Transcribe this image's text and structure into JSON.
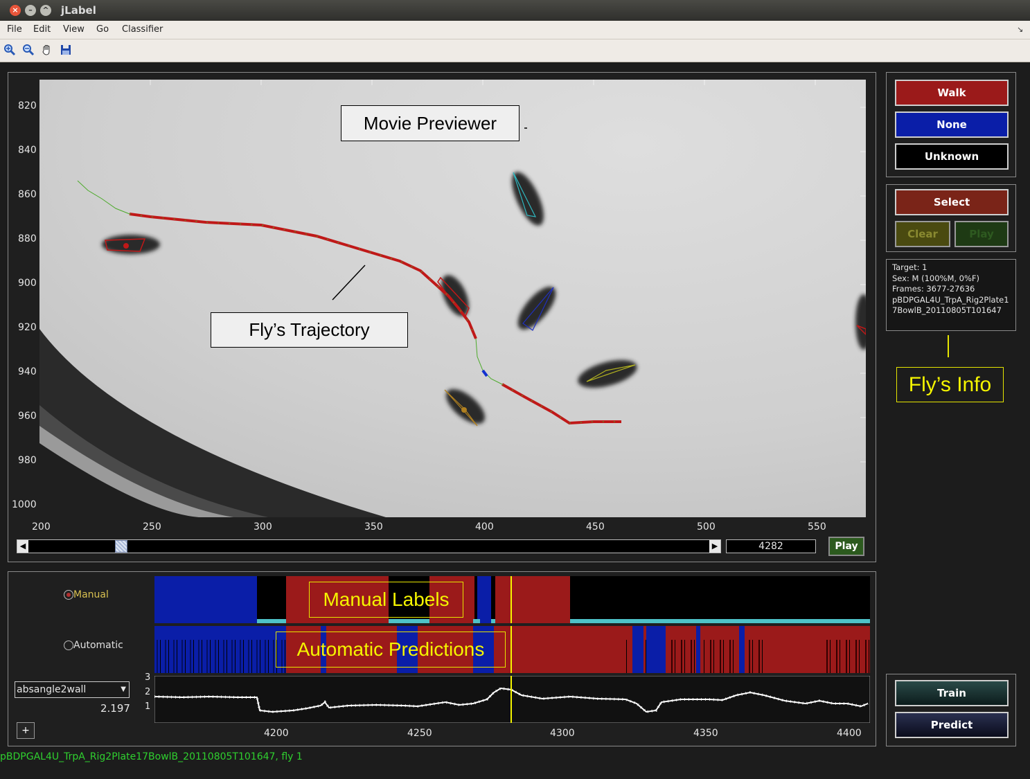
{
  "window": {
    "title": "jLabel"
  },
  "menu": [
    "File",
    "Edit",
    "View",
    "Go",
    "Classifier"
  ],
  "toolbar": {
    "icons": [
      "zoom-in-icon",
      "zoom-out-icon",
      "pan-hand-icon",
      "save-icon"
    ]
  },
  "previewer": {
    "y_ticks": [
      "820",
      "840",
      "860",
      "880",
      "900",
      "920",
      "940",
      "960",
      "980",
      "1000"
    ],
    "x_ticks": [
      "200",
      "250",
      "300",
      "350",
      "400",
      "450",
      "500",
      "550"
    ],
    "frame_value": "4282",
    "play_label": "Play",
    "slider_fraction": 0.13
  },
  "annotations": {
    "movie_previewer": "Movie Previewer",
    "fly_trajectory": "Fly’s Trajectory",
    "fly_info": "Fly’s Info",
    "manual_labels": "Manual Labels",
    "automatic_predictions": "Automatic Predictions"
  },
  "labels": {
    "walk": "Walk",
    "none": "None",
    "unknown": "Unknown"
  },
  "select_panel": {
    "select": "Select",
    "clear": "Clear",
    "play": "Play"
  },
  "fly_info": {
    "lines": [
      "Target: 1",
      "Sex: M (100%M, 0%F)",
      "Frames: 3677-27636",
      "pBDPGAL4U_TrpA_Rig2Plate1",
      "7BowlB_20110805T101647"
    ]
  },
  "timeline": {
    "manual_label": "Manual",
    "automatic_label": "Automatic",
    "feature_select": "absangle2wall",
    "feature_value": "2.197",
    "plus_label": "+",
    "y_ticks": [
      "3",
      "2",
      "1"
    ],
    "x_ticks": [
      "4200",
      "4250",
      "4300",
      "4350",
      "4400"
    ]
  },
  "classifier": {
    "train": "Train",
    "predict": "Predict"
  },
  "status": {
    "text": "pBDPGAL4U_TrpA_Rig2Plate17BowlB_20110805T101647, fly 1"
  },
  "colors": {
    "walk": "#9b1a1a",
    "none": "#0a1ea8",
    "unknown": "#000000",
    "status_text": "#2fd02f",
    "annotation_yellow": "#f5f500"
  }
}
